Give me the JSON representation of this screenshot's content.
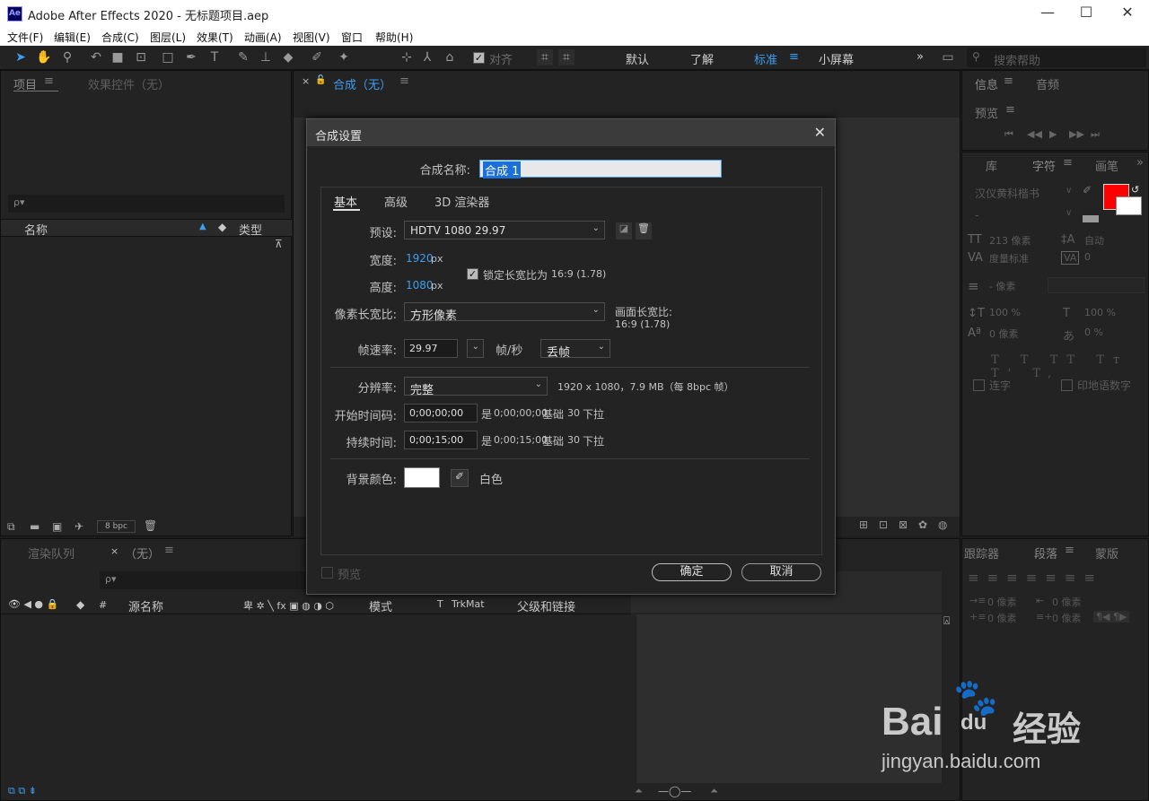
{
  "app": {
    "title": "Adobe After Effects 2020 - 无标题项目.aep",
    "logo": "Ae"
  },
  "window_controls": {
    "minimize": "—",
    "maximize": "☐",
    "close": "✕"
  },
  "menu": [
    "文件(F)",
    "编辑(E)",
    "合成(C)",
    "图层(L)",
    "效果(T)",
    "动画(A)",
    "视图(V)",
    "窗口",
    "帮助(H)"
  ],
  "toolbar": {
    "align_label": "对齐",
    "workspaces": [
      "默认",
      "了解",
      "标准",
      "小屏幕"
    ],
    "active_workspace": "标准",
    "more": "»",
    "search_placeholder": "搜索帮助"
  },
  "project_panel": {
    "tab_project": "项目",
    "tab_effects": "效果控件（无）",
    "search_icon": "ρ▾",
    "col_name": "名称",
    "col_type": "类型",
    "bpc": "8 bpc"
  },
  "comp_panel": {
    "tab": "合成（无）",
    "close": "×"
  },
  "info_panel": {
    "tab_info": "信息",
    "tab_audio": "音频",
    "preview": "预览"
  },
  "character_panel": {
    "tab_lib": "库",
    "tab_char": "字符",
    "tab_paint": "画笔",
    "font": "汉仪黄科楷书",
    "style": "-",
    "size": "213 像素",
    "leading": "自动",
    "kerning": "度量标准",
    "tracking": "0",
    "stroke": "- 像素",
    "vscale": "100 %",
    "hscale": "100 %",
    "baseline": "0 像素",
    "tsume": "0 %",
    "ligature": "连字",
    "hindi": "印地语数字",
    "fill_color": "#ff0000"
  },
  "paragraph_panel": {
    "tab_tracker": "跟踪器",
    "tab_paragraph": "段落",
    "tab_mask": "蒙版",
    "indent1": "0 像素",
    "indent2": "0 像素",
    "indent3": "0 像素",
    "indent4": "0 像素"
  },
  "timeline_panel": {
    "tab_render": "渲染队列",
    "tab_comp": "（无）",
    "col_source": "源名称",
    "col_mode": "模式",
    "col_t": "T",
    "col_trkmat": "TrkMat",
    "col_parent": "父级和链接",
    "col_hash": "#"
  },
  "dialog": {
    "title": "合成设置",
    "name_label": "合成名称:",
    "name_value": "合成 1",
    "tabs": [
      "基本",
      "高级",
      "3D 渲染器"
    ],
    "preset_label": "预设:",
    "preset_value": "HDTV 1080 29.97",
    "width_label": "宽度:",
    "width_value": "1920",
    "height_label": "高度:",
    "height_value": "1080",
    "px": "px",
    "lock_label": "锁定长宽比为",
    "lock_ratio": "16:9 (1.78)",
    "pixel_aspect_label": "像素长宽比:",
    "pixel_aspect_value": "方形像素",
    "frame_aspect_label": "画面长宽比:",
    "frame_aspect_value": "16:9 (1.78)",
    "fps_label": "帧速率:",
    "fps_value": "29.97",
    "fps_unit": "帧/秒",
    "drop_frame": "丢帧",
    "resolution_label": "分辨率:",
    "resolution_value": "完整",
    "resolution_info": "1920 x 1080，7.9 MB（每 8bpc 帧）",
    "start_tc_label": "开始时间码:",
    "start_tc_value": "0;00;00;00",
    "start_tc_info_prefix": "是",
    "start_tc_info": "0;00;00;00",
    "base_label": "基础",
    "base_value": "30",
    "drop_label": "下拉",
    "duration_label": "持续时间:",
    "duration_value": "0;00;15;00",
    "duration_info": "0;00;15;00",
    "bg_label": "背景颜色:",
    "bg_name": "白色",
    "bg_color": "#ffffff",
    "preview_label": "预览",
    "ok": "确定",
    "cancel": "取消"
  },
  "watermark": {
    "brand": "Bai",
    "brand2": "du",
    "jy": "经验",
    "url": "jingyan.baidu.com"
  }
}
